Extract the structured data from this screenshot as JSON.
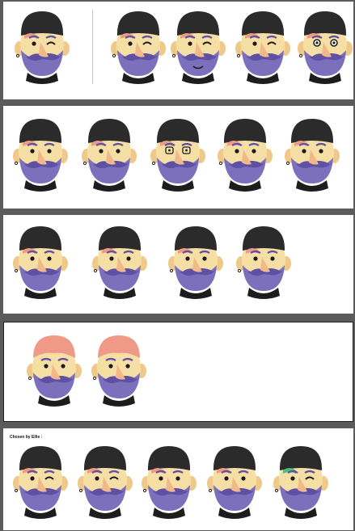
{
  "colors": {
    "skin": "#f6dfa4",
    "skin_shadow": "#efc98a",
    "nose": "#f1b889",
    "beard": "#7c6fbc",
    "beard_dark": "#5e51a3",
    "beanie": "#2b2b2b",
    "hair_pink": "#ef9a87",
    "hair_green": "#47c27a",
    "collar": "#1d1d1d",
    "eye": "#1b1b1b"
  },
  "panels": [
    {
      "caption": "",
      "heads": [
        {
          "variant": "wink",
          "hat": "beanie-icon",
          "hair": "pink"
        },
        {
          "variant": "wink",
          "hat": "beanie-icon",
          "hair": "pink"
        },
        {
          "variant": "wink-smile",
          "hat": "beanie-icon",
          "hair": "pink"
        },
        {
          "variant": "wink",
          "hat": "beanie-icon",
          "hair": "pink"
        },
        {
          "variant": "surprised",
          "hat": "beanie-icon",
          "hair": "pink"
        }
      ]
    },
    {
      "caption": "",
      "heads": [
        {
          "variant": "neutral",
          "hat": "beanie-icon",
          "hair": "pink"
        },
        {
          "variant": "neutral",
          "hat": "beanie-icon",
          "hair": "pink"
        },
        {
          "variant": "glasses",
          "hat": "beanie-icon",
          "hair": "pink"
        },
        {
          "variant": "neutral",
          "hat": "beanie-icon",
          "hair": "pink"
        },
        {
          "variant": "neutral",
          "hat": "beanie-icon",
          "hair": "pink"
        }
      ]
    },
    {
      "caption": "",
      "heads": [
        {
          "variant": "neutral",
          "hat": "beanie-icon",
          "hair": "pink"
        },
        {
          "variant": "neutral",
          "hat": "beanie-icon",
          "hair": "pink"
        },
        {
          "variant": "neutral",
          "hat": "beanie-icon",
          "hair": "pink"
        },
        {
          "variant": "neutral",
          "hat": "beanie-icon",
          "hair": "pink"
        }
      ]
    },
    {
      "caption": "",
      "heads": [
        {
          "variant": "neutral",
          "hat": "none",
          "hair": "pink"
        },
        {
          "variant": "neutral",
          "hat": "none",
          "hair": "pink"
        }
      ]
    },
    {
      "caption": "Chosen by Ellie :",
      "heads": [
        {
          "variant": "wink",
          "hat": "beanie-icon",
          "hair": "pink"
        },
        {
          "variant": "wink",
          "hat": "beanie-icon",
          "hair": "pink"
        },
        {
          "variant": "neutral",
          "hat": "beanie-icon",
          "hair": "pink"
        },
        {
          "variant": "neutral",
          "hat": "beanie-icon",
          "hair": "pink"
        },
        {
          "variant": "wink",
          "hat": "beanie-icon",
          "hair": "green"
        }
      ]
    }
  ]
}
